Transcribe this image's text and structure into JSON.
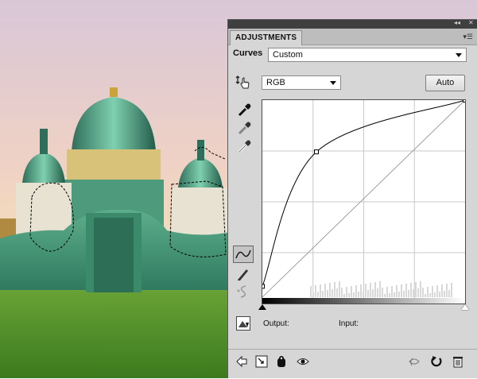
{
  "panel": {
    "tab_label": "ADJUSTMENTS",
    "preset_label": "Curves",
    "preset_value": "Custom",
    "channel_value": "RGB",
    "auto_label": "Auto",
    "output_label": "Output:",
    "input_label": "Input:"
  },
  "curve": {
    "control_points": [
      [
        0,
        14
      ],
      [
        68,
        188
      ],
      [
        255,
        255
      ]
    ]
  },
  "icons": {
    "collapse": "double-arrow-icon",
    "close": "close-icon",
    "menu": "panel-menu-icon"
  },
  "colors": {
    "panel_bg": "#d6d6d6",
    "titlebar": "#3f3f3f",
    "sky_top": "#e8c8d8",
    "grass": "#4f8a26"
  }
}
